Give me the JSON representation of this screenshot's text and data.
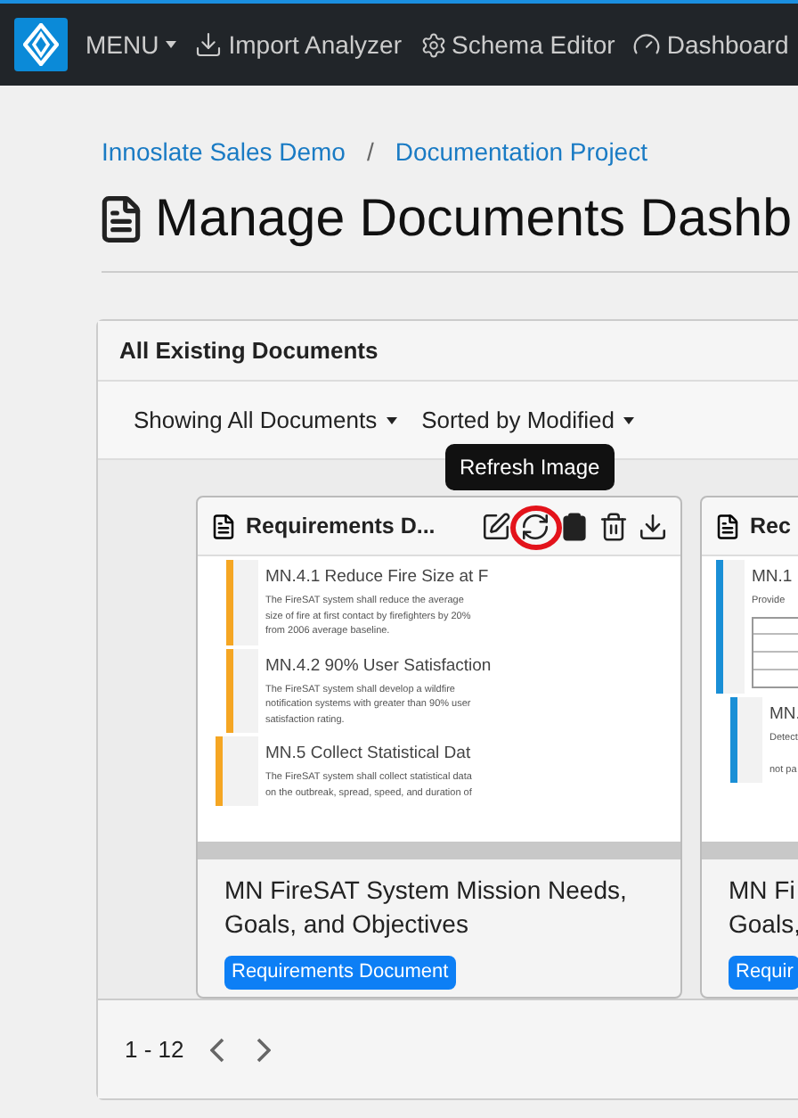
{
  "nav": {
    "menu": "MENU",
    "items": [
      {
        "label": "Import Analyzer",
        "kind": "import"
      },
      {
        "label": "Schema Editor",
        "kind": "gears"
      },
      {
        "label": "Dashboard",
        "kind": "gauge"
      }
    ]
  },
  "breadcrumb": [
    "Innoslate Sales Demo",
    "Documentation Project"
  ],
  "breadcrumb_separator": "/",
  "page_title": "Manage Documents Dashb",
  "panel": {
    "title": "All Existing Documents",
    "filters": [
      "Showing All Documents",
      "Sorted by Modified"
    ],
    "cards": [
      {
        "title": "Requirements D...",
        "color": "#f5a623",
        "actions": [
          {
            "kind": "edit"
          },
          {
            "kind": "refresh",
            "tooltip": "Refresh Image",
            "highlighted": true
          },
          {
            "kind": "clipboard"
          },
          {
            "kind": "trash"
          },
          {
            "kind": "download"
          }
        ],
        "preview": [
          {
            "kind": "subsection",
            "heading": "MN.4.1 Reduce Fire Size at F",
            "text": "The FireSAT system shall reduce the average size of fire at first contact by firefighters by 20% from 2006 average baseline."
          },
          {
            "kind": "subsection",
            "heading": "MN.4.2 90% User Satisfaction",
            "text": "The FireSAT system shall develop a wildfire notification systems with greater than 90% user satisfaction rating."
          },
          {
            "kind": "section",
            "heading": "MN.5 Collect Statistical Dat",
            "text": "The FireSAT system shall collect statistical data on the outbreak, spread, speed, and duration of"
          }
        ],
        "name_lines": [
          "MN FireSAT System Mission Needs,",
          "Goals, and Objectives"
        ],
        "badge": "Requirements Document"
      },
      {
        "title": "Rec",
        "color": "#1a8fd6",
        "preview": [
          {
            "kind": "table",
            "heading": "MN.1",
            "text": "Provide"
          },
          {
            "kind": "subsection",
            "heading": "MN.",
            "text": "Detect",
            "note": "not pa"
          }
        ],
        "name_lines": [
          "MN Fi",
          "Goals,"
        ],
        "badge": "Requir"
      }
    ],
    "pagination": {
      "range": "1 - 12"
    }
  }
}
